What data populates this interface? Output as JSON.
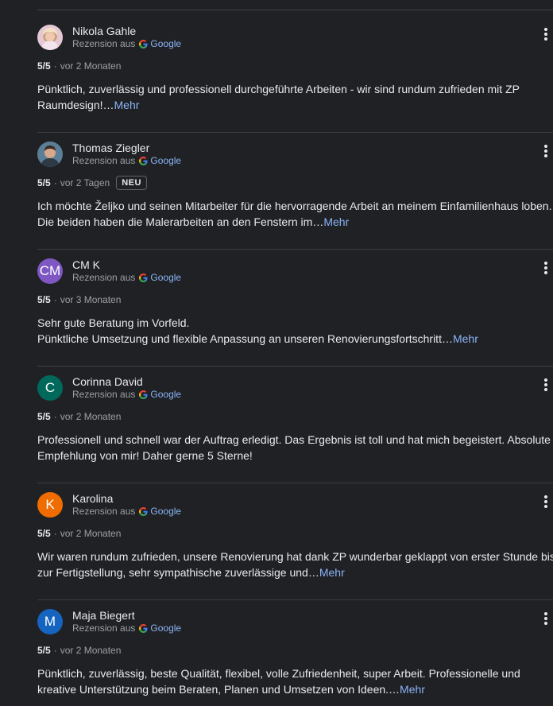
{
  "reviews": [
    {
      "name": "Nikola Gahle",
      "avatar": {
        "type": "photo",
        "icon": "woman-portrait-photo",
        "initials": ""
      },
      "source_prefix": "Rezension aus",
      "source_name": "Google",
      "rating": "5/5",
      "separator": "·",
      "time": "vor 2 Monaten",
      "badge": "",
      "lines": [
        "Pünktlich, zuverlässig und professionell durchgeführte Arbeiten - wir sind rundum zufrieden mit ZP",
        "Raumdesign!…"
      ],
      "more": "Mehr"
    },
    {
      "name": "Thomas Ziegler",
      "avatar": {
        "type": "photo",
        "icon": "man-portrait-photo",
        "initials": ""
      },
      "source_prefix": "Rezension aus",
      "source_name": "Google",
      "rating": "5/5",
      "separator": "·",
      "time": "vor 2 Tagen",
      "badge": "NEU",
      "lines": [
        "Ich möchte Željko und seinen Mitarbeiter für die hervorragende Arbeit an meinem Einfamilienhaus loben.",
        "Die beiden haben die Malerarbeiten an den Fenstern im…"
      ],
      "more": "Mehr"
    },
    {
      "name": "CM K",
      "avatar": {
        "type": "initials",
        "icon": "",
        "initials": "CM",
        "color": "#7e57c2"
      },
      "source_prefix": "Rezension aus",
      "source_name": "Google",
      "rating": "5/5",
      "separator": "·",
      "time": "vor 3 Monaten",
      "badge": "",
      "lines": [
        "Sehr gute Beratung im Vorfeld.",
        "Pünktliche Umsetzung und flexible Anpassung an unseren Renovierungsfortschritt…"
      ],
      "more": "Mehr"
    },
    {
      "name": "Corinna David",
      "avatar": {
        "type": "initials",
        "icon": "",
        "initials": "C",
        "color": "#00695c"
      },
      "source_prefix": "Rezension aus",
      "source_name": "Google",
      "rating": "5/5",
      "separator": "·",
      "time": "vor 2 Monaten",
      "badge": "",
      "lines": [
        "Professionell und schnell war der Auftrag erledigt. Das Ergebnis ist toll und hat mich begeistert. Absolute",
        "Empfehlung von mir! Daher gerne 5 Sterne!"
      ],
      "more": ""
    },
    {
      "name": "Karolina",
      "avatar": {
        "type": "initials",
        "icon": "",
        "initials": "K",
        "color": "#ef6c00"
      },
      "source_prefix": "Rezension aus",
      "source_name": "Google",
      "rating": "5/5",
      "separator": "·",
      "time": "vor 2 Monaten",
      "badge": "",
      "lines": [
        "Wir waren rundum zufrieden, unsere Renovierung hat dank ZP wunderbar geklappt von erster Stunde bis",
        "zur Fertigstellung, sehr sympathische zuverlässige und…"
      ],
      "more": "Mehr"
    },
    {
      "name": "Maja Biegert",
      "avatar": {
        "type": "initials",
        "icon": "",
        "initials": "M",
        "color": "#1565c0"
      },
      "source_prefix": "Rezension aus",
      "source_name": "Google",
      "rating": "5/5",
      "separator": "·",
      "time": "vor 2 Monaten",
      "badge": "",
      "lines": [
        "Pünktlich, zuverlässig, beste Qualität, flexibel, volle Zufriedenheit, super Arbeit. Professionelle und",
        "kreative Unterstützung beim Beraten, Planen und Umsetzen von Ideen.…"
      ],
      "more": "Mehr"
    }
  ],
  "colors": {
    "background": "#202124",
    "text": "#e8eaed",
    "secondary_text": "#9aa0a6",
    "link": "#8ab4f8",
    "divider": "#3c4043"
  },
  "icons": {
    "source": "google-g-icon",
    "menu": "more-vert-icon"
  }
}
